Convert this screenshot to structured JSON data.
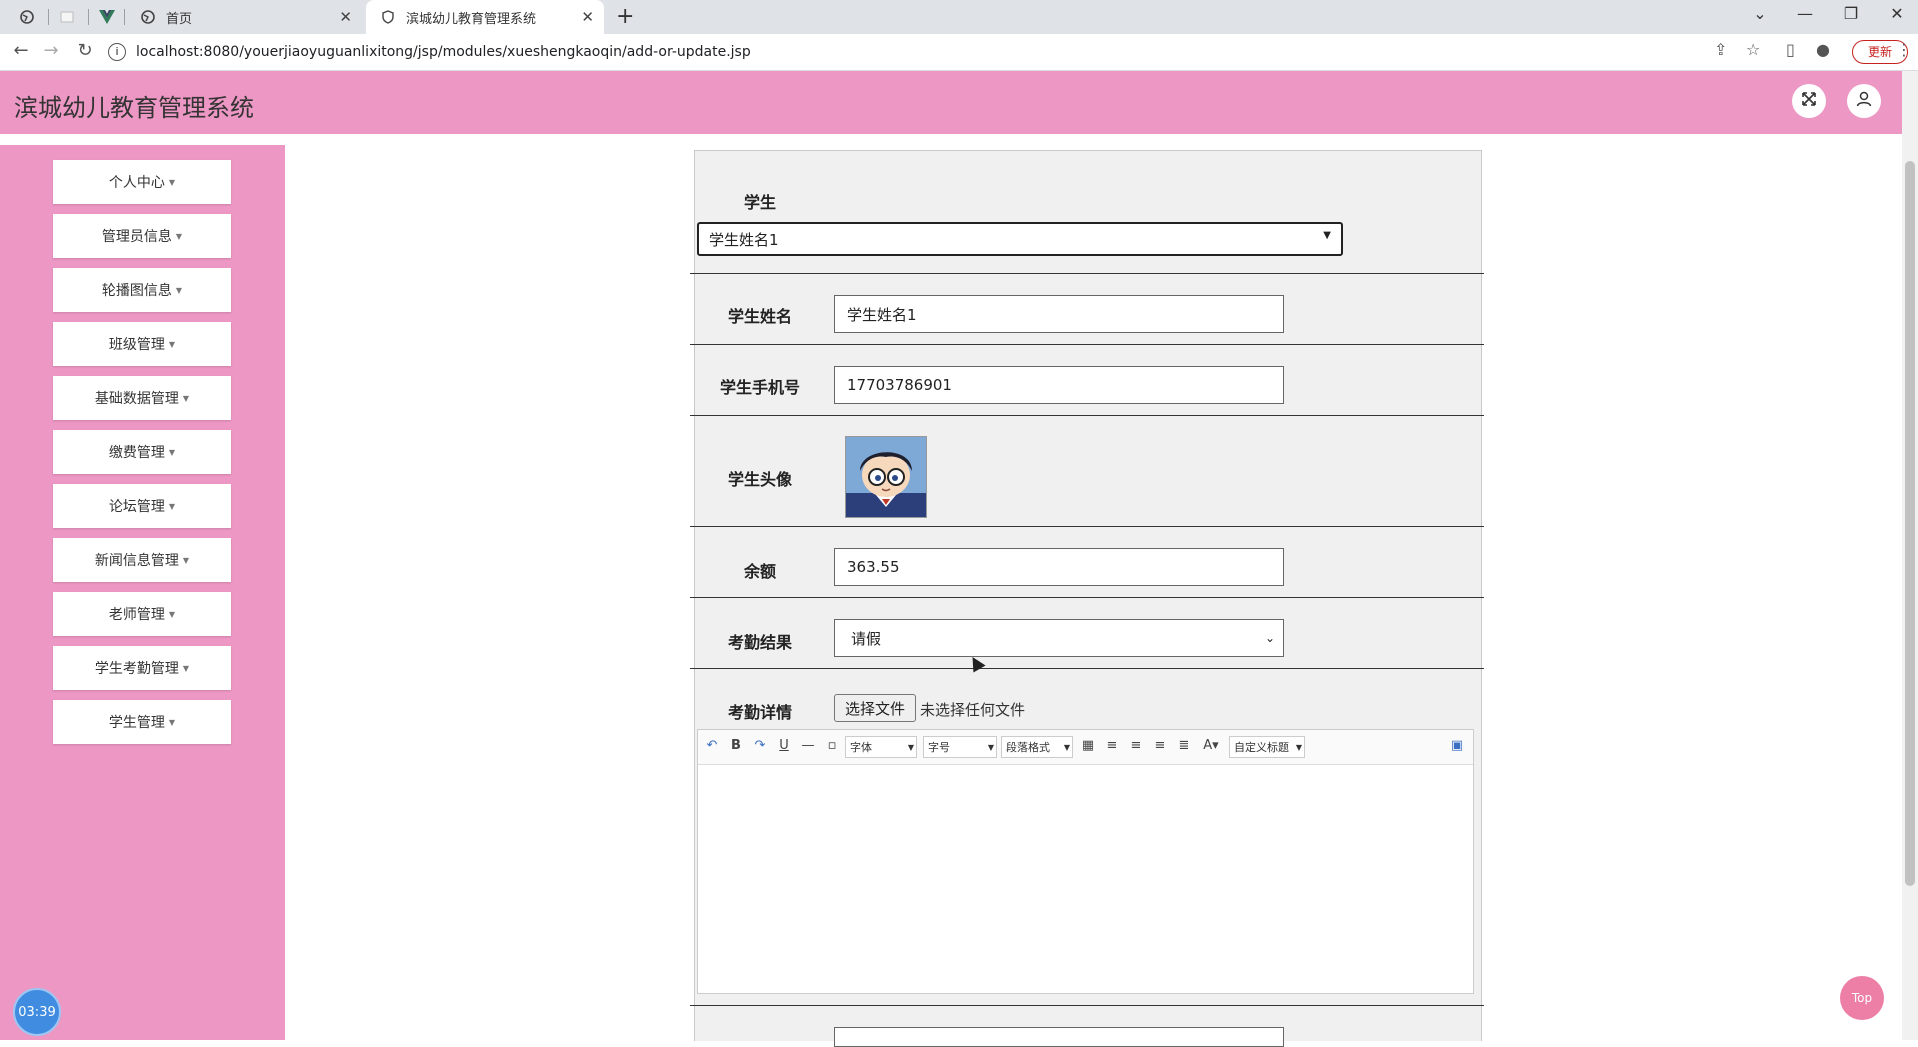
{
  "browser": {
    "tabs": [
      {
        "label": ""
      },
      {
        "label": ""
      },
      {
        "label": ""
      },
      {
        "label": "首页"
      },
      {
        "label": "滨城幼儿教育管理系统"
      }
    ],
    "url": "localhost:8080/youerjiaoyuguanlixitong/jsp/modules/xueshengkaoqin/add-or-update.jsp",
    "update_label": "更新"
  },
  "app": {
    "title": "滨城幼儿教育管理系统"
  },
  "sidebar": {
    "items": [
      {
        "label": "个人中心"
      },
      {
        "label": "管理员信息"
      },
      {
        "label": "轮播图信息"
      },
      {
        "label": "班级管理"
      },
      {
        "label": "基础数据管理"
      },
      {
        "label": "缴费管理"
      },
      {
        "label": "论坛管理"
      },
      {
        "label": "新闻信息管理"
      },
      {
        "label": "老师管理"
      },
      {
        "label": "学生考勤管理"
      },
      {
        "label": "学生管理"
      }
    ]
  },
  "form": {
    "student_label": "学生",
    "student_select": "学生姓名1",
    "name_label": "学生姓名",
    "name_value": "学生姓名1",
    "phone_label": "学生手机号",
    "phone_value": "17703786901",
    "avatar_label": "学生头像",
    "balance_label": "余额",
    "balance_value": "363.55",
    "result_label": "考勤结果",
    "result_value": "请假",
    "detail_label": "考勤详情",
    "file_button": "选择文件",
    "file_status": "未选择任何文件"
  },
  "editor": {
    "font_family": "字体",
    "font_size": "字号",
    "paragraph": "段落格式",
    "custom_title": "自定义标题"
  },
  "widgets": {
    "clock": "03:39",
    "top": "Top"
  },
  "colors": {
    "header": "#ed97c4",
    "sidebar": "#ed97c4",
    "top_button": "#ed7fa6",
    "clock": "#3f8ce0"
  }
}
